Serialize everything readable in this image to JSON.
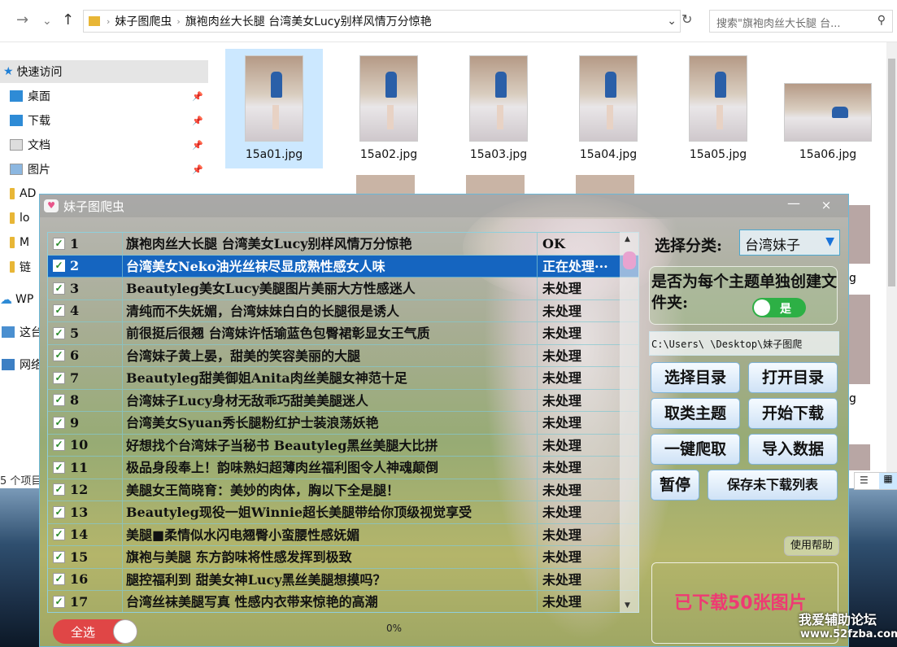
{
  "explorer": {
    "back": "←",
    "forward": "→",
    "recent": "⌄",
    "up": "↑",
    "breadcrumb": [
      "妹子图爬虫",
      "旗袍肉丝大长腿 台湾美女Lucy别样风情万分惊艳"
    ],
    "search_placeholder": "搜索\"旗袍肉丝大长腿 台...",
    "nav_items": [
      {
        "label": "快速访问"
      },
      {
        "label": "桌面"
      },
      {
        "label": "下载"
      },
      {
        "label": "文档"
      },
      {
        "label": "图片"
      },
      {
        "label": "AD"
      },
      {
        "label": "lo"
      },
      {
        "label": "M"
      },
      {
        "label": "链"
      },
      {
        "label": "WP"
      },
      {
        "label": "这台"
      },
      {
        "label": "网络"
      }
    ],
    "status": "5 个项目",
    "files": [
      "15a01.jpg",
      "15a02.jpg",
      "15a03.jpg",
      "15a04.jpg",
      "15a05.jpg",
      "15a06.jpg"
    ],
    "partial_right_labels": [
      "g",
      "g"
    ]
  },
  "app": {
    "title": "妹子图爬虫",
    "min_glyph": "—",
    "close_glyph": "×",
    "rows": [
      {
        "num": "1",
        "title": "旗袍肉丝大长腿 台湾美女Lucy别样风情万分惊艳",
        "status": "OK"
      },
      {
        "num": "2",
        "title": "台湾美女Neko油光丝袜尽显成熟性感女人味",
        "status": "正在处理···"
      },
      {
        "num": "3",
        "title": "Beautyleg美女Lucy美腿图片美丽大方性感迷人",
        "status": "未处理"
      },
      {
        "num": "4",
        "title": "清纯而不失妩媚，台湾妹妹白白的长腿很是诱人",
        "status": "未处理"
      },
      {
        "num": "5",
        "title": "前很挺后很翘 台湾妹许恬瑜蓝色包臀裙彰显女王气质",
        "status": "未处理"
      },
      {
        "num": "6",
        "title": "台湾妹子黄上晏，甜美的笑容美丽的大腿",
        "status": "未处理"
      },
      {
        "num": "7",
        "title": "Beautyleg甜美御姐Anita肉丝美腿女神范十足",
        "status": "未处理"
      },
      {
        "num": "8",
        "title": "台湾妹子Lucy身材无敌乖巧甜美美腿迷人",
        "status": "未处理"
      },
      {
        "num": "9",
        "title": "台湾美女Syuan秀长腿粉红护士装浪荡妖艳",
        "status": "未处理"
      },
      {
        "num": "10",
        "title": "好想找个台湾妹子当秘书 Beautyleg黑丝美腿大比拼",
        "status": "未处理"
      },
      {
        "num": "11",
        "title": "极品身段奉上！韵味熟妇超薄肉丝福利图令人神魂颠倒",
        "status": "未处理"
      },
      {
        "num": "12",
        "title": "美腿女王简晓育：美妙的肉体，胸以下全是腿！",
        "status": "未处理"
      },
      {
        "num": "13",
        "title": "Beautyleg现役一姐Winnie超长美腿带给你顶级视觉享受",
        "status": "未处理"
      },
      {
        "num": "14",
        "title": "美腿■柔情似水闪电翘臀小蛮腰性感妩媚",
        "status": "未处理"
      },
      {
        "num": "15",
        "title": "旗袍与美腿 东方韵味将性感发挥到极致",
        "status": "未处理"
      },
      {
        "num": "16",
        "title": "腿控福利到 甜美女神Lucy黑丝美腿想摸吗？",
        "status": "未处理"
      },
      {
        "num": "17",
        "title": "台湾丝袜美腿写真 性感内衣带来惊艳的高潮",
        "status": "未处理"
      }
    ],
    "category_label": "选择分类:",
    "category_value": "台湾妹子",
    "question": "是否为每个主题单独创建文件夹:",
    "toggle_label": "是",
    "path": "C:\\Users\\      \\Desktop\\妹子图爬",
    "buttons": {
      "select_dir": "选择目录",
      "open_dir": "打开目录",
      "get_topics": "取类主题",
      "start_download": "开始下载",
      "one_click": "一键爬取",
      "import_data": "导入数据",
      "pause": "暂停",
      "save_list": "保存未下载列表"
    },
    "help": "使用帮助",
    "downloaded": "已下载50张图片",
    "select_all": "全选",
    "progress_text": "0%",
    "selected_row": 1
  },
  "watermark": {
    "line1": "我爱辅助论坛",
    "line2": "www.52fzba.com"
  },
  "colors": {
    "selected_row": "#1565c0",
    "download_text": "#ee3a73",
    "toggle_on": "#2db045",
    "select_all": "#e04646"
  }
}
